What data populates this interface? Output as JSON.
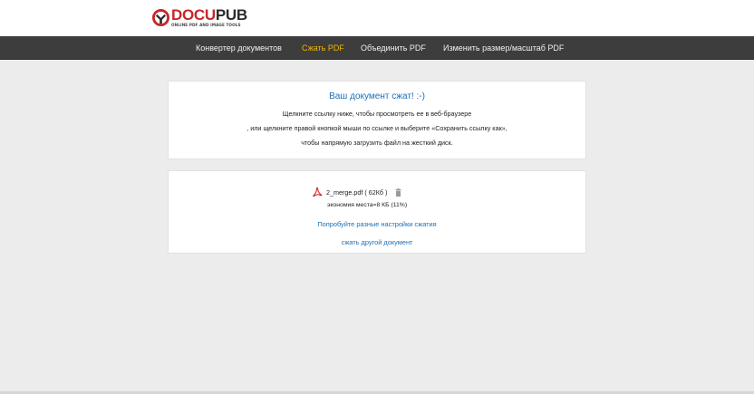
{
  "header": {
    "logo_docu": "DOCU",
    "logo_pub": "PUB",
    "logo_tagline": "ONLINE PDF AND IMAGE TOOLS",
    "logo_icon": "docupub-logo-icon"
  },
  "nav": {
    "items": [
      {
        "label": "Конвертер документов"
      },
      {
        "label": "Сжать PDF",
        "active": true
      },
      {
        "label": "Объединить PDF"
      },
      {
        "label": "Изменить размер/масштаб PDF"
      }
    ]
  },
  "message": {
    "title": "Ваш документ сжат! :-)",
    "line1": "Щелкните ссылку ниже, чтобы просмотреть ее в веб-браузере",
    "line2": ", или щелкните правой кнопкой мыши по ссылке и выберите «Сохранить ссылку как»,",
    "line3": "чтобы напрямую загрузить файл на жесткий диск."
  },
  "result": {
    "file_name": "2_merge.pdf",
    "file_size": "( 62Кб )",
    "savings": "экономия места=8 КБ (11%)",
    "file_icon": "pdf-icon",
    "delete_icon": "trash-icon",
    "link_try_settings": "Попробуйте разные настройки сжатия",
    "link_compress_other": "сжать другой документ"
  },
  "colors": {
    "accent": "#1d6fb8",
    "nav_active": "#f5b400",
    "nav_bg": "#3d3d3d",
    "brand_red": "#c7262b",
    "page_bg": "#ececec"
  }
}
